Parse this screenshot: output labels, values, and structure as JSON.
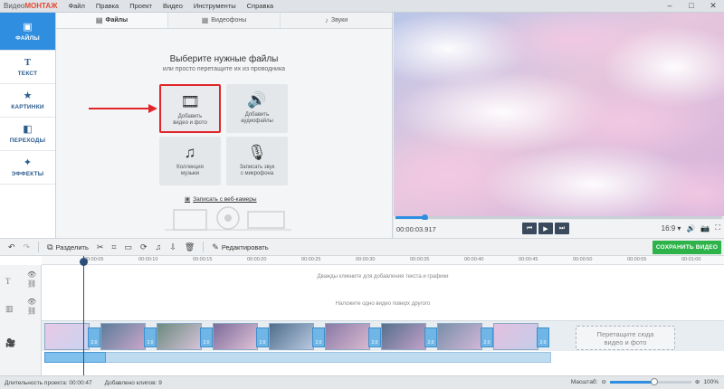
{
  "app": {
    "logo_prefix": "Видео",
    "logo_brand": "МОНТАЖ",
    "menu": [
      "Файл",
      "Правка",
      "Проект",
      "Видео",
      "Инструменты",
      "Справка"
    ],
    "window_controls": [
      "–",
      "□",
      "✕"
    ]
  },
  "sidebar": {
    "items": [
      {
        "label": "ФАЙЛЫ",
        "icon": "image-icon",
        "glyph": "▣",
        "active": true
      },
      {
        "label": "ТЕКСТ",
        "icon": "text-icon",
        "glyph": "T",
        "active": false
      },
      {
        "label": "КАРТИНКИ",
        "icon": "star-icon",
        "glyph": "★",
        "active": false
      },
      {
        "label": "ПЕРЕХОДЫ",
        "icon": "transitions-icon",
        "glyph": "◧",
        "active": false
      },
      {
        "label": "ЭФФЕКТЫ",
        "icon": "magic-wand-icon",
        "glyph": "✦",
        "active": false
      }
    ]
  },
  "files_panel": {
    "tabs": [
      {
        "label": "Файлы",
        "glyph": "▤",
        "active": true
      },
      {
        "label": "Видеофоны",
        "glyph": "▦",
        "active": false
      },
      {
        "label": "Звуки",
        "glyph": "♪",
        "active": false
      }
    ],
    "title": "Выберите нужные файлы",
    "subtitle": "или просто перетащите их из проводника",
    "tiles": {
      "add_video": {
        "label": "Добавить\nвидео и фото",
        "glyph": "🎞"
      },
      "add_audio": {
        "label": "Добавить\nаудиофайлы",
        "glyph": "🔊"
      },
      "music": {
        "label": "Коллекция\nмузыки",
        "glyph": "♫"
      },
      "record": {
        "label": "Записать звук\nс микрофона",
        "glyph": "🎙"
      }
    },
    "webcam_link": "Записать с веб-камеры",
    "webcam_glyph": "▣"
  },
  "preview": {
    "timecode": "00:00:03.917",
    "progress_fraction": 0.09,
    "aspect": "16:9"
  },
  "toolbar": {
    "split_label": "Разделить",
    "edit_label": "Редактировать",
    "save_label": "СОХРАНИТЬ ВИДЕО"
  },
  "timeline": {
    "ticks": [
      "00:00:05",
      "00:00:10",
      "00:00:15",
      "00:00:20",
      "00:00:25",
      "00:00:30",
      "00:00:35",
      "00:00:40",
      "00:00:45",
      "00:00:50",
      "00:00:55",
      "00:01:00"
    ],
    "hint_text": "Дважды кликните для добавления текста и графики",
    "hint_overlay": "Наложите одно видео поверх другого",
    "drop_zone": "Перетащите сюда\nвидео и фото",
    "transition_label": "2.0",
    "clip_count": 9
  },
  "status": {
    "duration": "Длительность проекта: 00:00:47",
    "clips": "Добавлено клипов: 9",
    "zoom_label": "Масштаб:",
    "zoom_value": "100%",
    "zoom_fraction": 0.55
  },
  "colors": {
    "accent": "#2f8ee0",
    "save_green": "#2db34a",
    "highlight_red": "#e0262a"
  }
}
